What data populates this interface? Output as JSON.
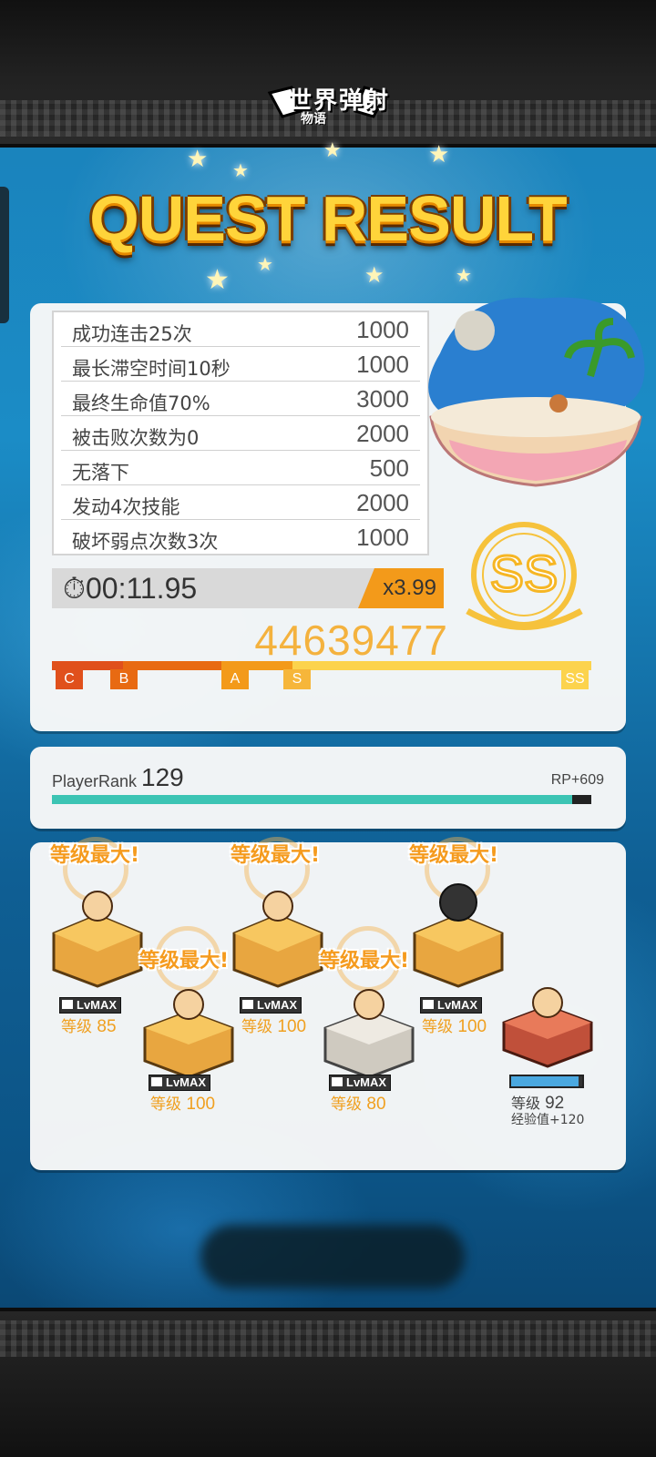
{
  "header": {
    "logo_main": "世界弹射",
    "logo_sub": "物语"
  },
  "title": "QUEST RESULT",
  "bonus_rows": [
    {
      "label": "成功连击25次",
      "value": "1000"
    },
    {
      "label": "最长滞空时间10秒",
      "value": "1000"
    },
    {
      "label": "最终生命值70%",
      "value": "3000"
    },
    {
      "label": "被击败次数为0",
      "value": "2000"
    },
    {
      "label": "无落下",
      "value": "500"
    },
    {
      "label": "发动4次技能",
      "value": "2000"
    },
    {
      "label": "破坏弱点次数3次",
      "value": "1000"
    }
  ],
  "clear_time": "00:11.95",
  "multiplier": "x3.99",
  "score": "44639477",
  "result_rank": "SS",
  "rank_track": {
    "markers": [
      "C",
      "B",
      "A",
      "S",
      "SS"
    ],
    "colors": {
      "C": "#e0501c",
      "B": "#e86a12",
      "A": "#f39a1a",
      "S": "#f6b63a",
      "SS": "#fcd34d"
    }
  },
  "player": {
    "label": "PlayerRank",
    "rank": "129",
    "rp": "RP+609",
    "progress": 0.965
  },
  "units": [
    {
      "badge": "等级最大!",
      "lvmax": "LvMAX",
      "level_label": "等级",
      "level": "85"
    },
    {
      "badge": "等级最大!",
      "lvmax": "LvMAX",
      "level_label": "等级",
      "level": "100"
    },
    {
      "badge": "等级最大!",
      "lvmax": "LvMAX",
      "level_label": "等级",
      "level": "100"
    },
    {
      "badge": "等级最大!",
      "lvmax": "LvMAX",
      "level_label": "等级",
      "level": "80"
    },
    {
      "badge": "等级最大!",
      "lvmax": "LvMAX",
      "level_label": "等级",
      "level": "100"
    },
    {
      "level_label": "等级",
      "level": "92",
      "exp": "经验值+120",
      "exp_progress": 0.95
    }
  ]
}
